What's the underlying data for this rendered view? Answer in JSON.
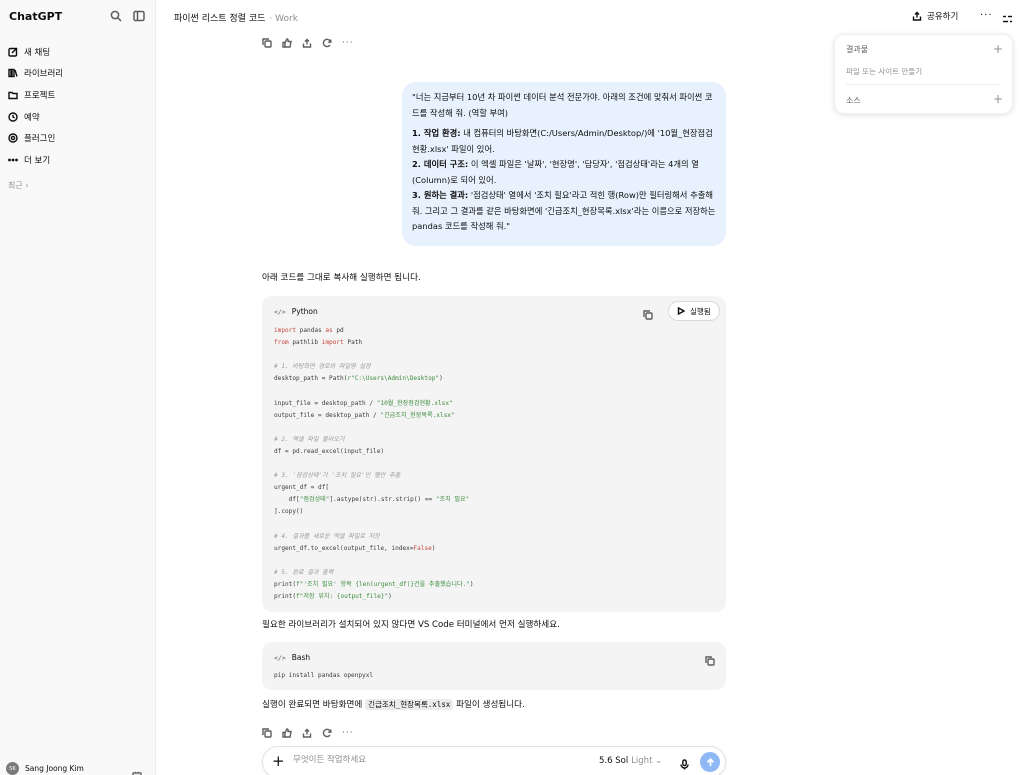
{
  "sidebar": {
    "brand": "ChatGPT",
    "items": [
      {
        "label": "새 채팅",
        "icon": "edit-icon"
      },
      {
        "label": "라이브러리",
        "icon": "library-icon"
      },
      {
        "label": "프로젝트",
        "icon": "folder-icon"
      },
      {
        "label": "예약",
        "icon": "clock-icon"
      },
      {
        "label": "플러그인",
        "icon": "plugin-icon"
      },
      {
        "label": "더 보기",
        "icon": "more-icon"
      }
    ],
    "recent_label": "최근 ›",
    "user": {
      "name": "Sang Joong Kim",
      "initials": "SK"
    }
  },
  "header": {
    "title": "파이썬 리스트 정렬 코드",
    "subtitle": "· Work",
    "share_label": "공유하기"
  },
  "right_panel": {
    "results_title": "결과물",
    "results_sub": "파일 또는 사이트 만들기",
    "sources_title": "소스"
  },
  "user_message": {
    "intro": "\"너는 지금부터 10년 차 파이썬 데이터 분석 전문가야. 아래의 조건에 맞춰서 파이썬 코드를 작성해 줘. (역할 부여)",
    "points": [
      {
        "head": "1. 작업 환경:",
        "text": " 내 컴퓨터의 바탕화면(C:/Users/Admin/Desktop/)에 '10월_현장점검현황.xlsx' 파일이 있어."
      },
      {
        "head": "2. 데이터 구조:",
        "text": " 이 엑셀 파일은 '날짜', '현장명', '담당자', '점검상태'라는 4개의 열(Column)로 되어 있어."
      },
      {
        "head": "3. 원하는 결과:",
        "text": " '점검상태' 열에서 '조치 필요'라고 적힌 행(Row)만 필터링해서 추출해 줘. 그리고 그 결과를 같은 바탕화면에 '긴급조치_현장목록.xlsx'라는 이름으로 저장하는 pandas 코드를 작성해 줘.\""
      }
    ]
  },
  "assistant": {
    "intro": "아래 코드를 그대로 복사해 실행하면 됩니다.",
    "code1": {
      "lang": "Python",
      "lang_icon": "</>",
      "run_label": "실행됨",
      "lines": [
        [
          [
            "kw",
            "import"
          ],
          [
            "fn",
            " pandas "
          ],
          [
            "kw",
            "as"
          ],
          [
            "fn",
            " pd"
          ]
        ],
        [
          [
            "kw",
            "from"
          ],
          [
            "fn",
            " pathlib "
          ],
          [
            "kw",
            "import"
          ],
          [
            "fn",
            " Path"
          ]
        ],
        [],
        [
          [
            "cm",
            "# 1. 바탕화면 경로와 파일명 설정"
          ]
        ],
        [
          [
            "fn",
            "desktop_path = Path("
          ],
          [
            "st",
            "r\"C:\\Users\\Admin\\Desktop\""
          ],
          [
            "fn",
            ")"
          ]
        ],
        [],
        [
          [
            "fn",
            "input_file = desktop_path / "
          ],
          [
            "st",
            "\"10월_현장점검현황.xlsx\""
          ]
        ],
        [
          [
            "fn",
            "output_file = desktop_path / "
          ],
          [
            "st",
            "\"긴급조치_현장목록.xlsx\""
          ]
        ],
        [],
        [
          [
            "cm",
            "# 2. 엑셀 파일 불러오기"
          ]
        ],
        [
          [
            "fn",
            "df = pd.read_excel(input_file)"
          ]
        ],
        [],
        [
          [
            "cm",
            "# 3. '점검상태'가 '조치 필요'인 행만 추출"
          ]
        ],
        [
          [
            "fn",
            "urgent_df = df["
          ]
        ],
        [
          [
            "fn",
            "    df["
          ],
          [
            "st",
            "\"점검상태\""
          ],
          [
            "fn",
            "].astype(str).str.strip() == "
          ],
          [
            "st",
            "\"조치 필요\""
          ]
        ],
        [
          [
            "fn",
            "].copy()"
          ]
        ],
        [],
        [
          [
            "cm",
            "# 4. 결과를 새로운 엑셀 파일로 저장"
          ]
        ],
        [
          [
            "fn",
            "urgent_df.to_excel(output_file, index="
          ],
          [
            "kw",
            "False"
          ],
          [
            "fn",
            ")"
          ]
        ],
        [],
        [
          [
            "cm",
            "# 5. 완료 결과 출력"
          ]
        ],
        [
          [
            "fn",
            "print("
          ],
          [
            "st",
            "f\"'조치 필요' 항목 {len(urgent_df)}건을 추출했습니다.\""
          ],
          [
            "fn",
            ")"
          ]
        ],
        [
          [
            "fn",
            "print("
          ],
          [
            "st",
            "f\"저장 위치: {output_file}\""
          ],
          [
            "fn",
            ")"
          ]
        ]
      ]
    },
    "mid_text": "필요한 라이브러리가 설치되어 있지 않다면 VS Code 터미널에서 먼저 실행하세요.",
    "code2": {
      "lang": "Bash",
      "lang_icon": "</>",
      "lines": [
        [
          [
            "fn",
            "pip install pandas openpyxl"
          ]
        ]
      ]
    },
    "outro_before": "실행이 완료되면 바탕화면에 ",
    "outro_code": "긴급조치_현장목록.xlsx",
    "outro_after": " 파일이 생성됩니다."
  },
  "composer": {
    "placeholder": "무엇이든 작업하세요",
    "model_name": "5.6 Sol",
    "model_mode": "Light ⌄"
  },
  "colors": {
    "bubble": "#e8f2fe",
    "send_button": "#8fb8f5",
    "keyword": "#c5453b",
    "string": "#3d8c3d",
    "comment": "#9a9a9a"
  }
}
